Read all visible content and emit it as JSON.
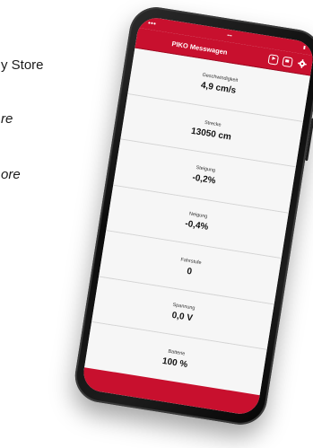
{
  "background_text": [
    "y Store",
    "re",
    "ore"
  ],
  "colors": {
    "brand_red": "#c8102e",
    "screen_bg": "#f6f6f6",
    "text_dark": "#111111"
  },
  "app": {
    "title": "PIKO Messwagen",
    "icons": [
      "play-icon",
      "stop-icon",
      "gear-icon"
    ]
  },
  "measurements": [
    {
      "label": "Geschwindigkeit",
      "value": "4,9 cm/s"
    },
    {
      "label": "Strecke",
      "value": "13050 cm"
    },
    {
      "label": "Steigung",
      "value": "-0,2%"
    },
    {
      "label": "Neigung",
      "value": "-0,4%"
    },
    {
      "label": "Fahrstufe",
      "value": "0"
    },
    {
      "label": "Spannung",
      "value": "0,0 V"
    },
    {
      "label": "Batterie",
      "value": "100 %"
    }
  ]
}
